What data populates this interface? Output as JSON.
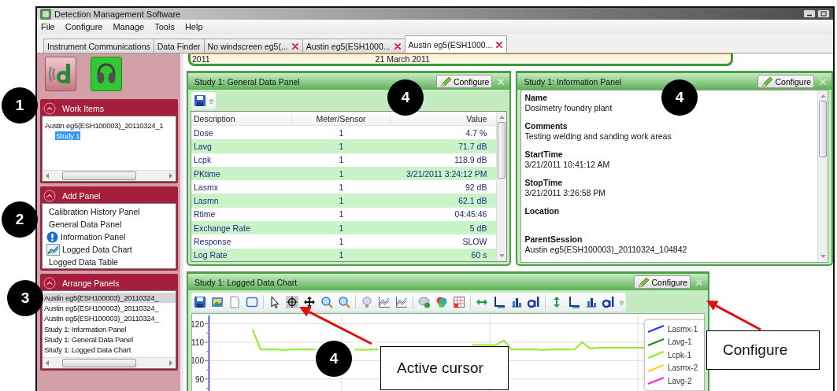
{
  "window": {
    "title": "Detection Management Software"
  },
  "menu": [
    "File",
    "Configure",
    "Manage",
    "Tools",
    "Help"
  ],
  "tabs": [
    {
      "label": "Instrument Communications",
      "closable": false,
      "selected": false
    },
    {
      "label": "Data Finder",
      "closable": false,
      "selected": false
    },
    {
      "label": "No windscreen eg5(...",
      "closable": true,
      "selected": false
    },
    {
      "label": "Austin eg5(ESH1000...",
      "closable": true,
      "selected": false
    },
    {
      "label": "Austin eg5(ESH1000...",
      "closable": true,
      "selected": true
    }
  ],
  "sidebar": {
    "launch_buttons": [
      {
        "kind": "logo"
      },
      {
        "kind": "headphones"
      }
    ],
    "work_items": {
      "title": "Work Items",
      "tree": [
        {
          "label": "Austin eg5(ESH100003)_20110324_1",
          "selected": false,
          "children": [
            {
              "label": "Study 1",
              "selected": true
            }
          ]
        }
      ]
    },
    "add_panel": {
      "title": "Add Panel",
      "items": [
        {
          "label": "Calibration History Panel",
          "kind": "plain"
        },
        {
          "label": "General Data Panel",
          "kind": "plain"
        },
        {
          "label": "Information Panel",
          "kind": "info"
        },
        {
          "label": "Logged Data Chart",
          "kind": "chart"
        },
        {
          "label": "Logged Data Table",
          "kind": "plain"
        }
      ]
    },
    "arrange_panels": {
      "title": "Arrange Panels",
      "items": [
        {
          "label": "Austin eg5(ESH100003)_20110324_",
          "selected": true
        },
        {
          "label": "Austin eg5(ESH100003)_20110324_",
          "selected": false
        },
        {
          "label": "Austin eg5(ESH100003)_20110324_",
          "selected": false
        },
        {
          "label": "Study 1: Information Panel",
          "selected": false
        },
        {
          "label": "Study 1: General Data Panel",
          "selected": false
        },
        {
          "label": "Study 1: Logged Data Chart",
          "selected": false
        }
      ]
    }
  },
  "timeline": {
    "year": "2011",
    "date": "21 March 2011"
  },
  "general_panel": {
    "title": "Study 1: General Data Panel",
    "configure": "Configure",
    "columns": [
      "Description",
      "Meter/Sensor",
      "Value"
    ],
    "rows": [
      [
        "Dose",
        "1",
        "4.7 %"
      ],
      [
        "Lavg",
        "1",
        "71.7 dB"
      ],
      [
        "Lcpk",
        "1",
        "118.9 dB"
      ],
      [
        "PKtime",
        "1",
        "3/21/2011 3:24:12 PM"
      ],
      [
        "Lasmx",
        "1",
        "92 dB"
      ],
      [
        "Lasmn",
        "1",
        "62.1 dB"
      ],
      [
        "Rtime",
        "1",
        "04:45:46"
      ],
      [
        "Exchange Rate",
        "1",
        "5 dB"
      ],
      [
        "Response",
        "1",
        "SLOW"
      ],
      [
        "Log Rate",
        "1",
        "60 s"
      ]
    ]
  },
  "info_panel": {
    "title": "Study 1: Information Panel",
    "configure": "Configure",
    "fields": [
      {
        "label": "Name",
        "value": "Dosimetry foundry plant"
      },
      {
        "label": "Comments",
        "value": "Testing welding and sanding work areas"
      },
      {
        "label": "StartTime",
        "value": "3/21/2011 10:41:12 AM"
      },
      {
        "label": "StopTime",
        "value": "3/21/2011 3:26:58 PM"
      },
      {
        "label": "Location"
      },
      {
        "label": "ParentSession",
        "value": "Austin eg5(ESH100003)_20110324_104842"
      }
    ]
  },
  "chart_panel": {
    "title": "Study 1: Logged Data Chart",
    "configure": "Configure",
    "toolbar": [
      {
        "kind": "save",
        "selected": false
      },
      {
        "kind": "image",
        "selected": false
      },
      {
        "kind": "page",
        "selected": false
      },
      {
        "kind": "window",
        "selected": false
      },
      {
        "kind": "separator"
      },
      {
        "kind": "pointer",
        "selected": false
      },
      {
        "kind": "cursor",
        "selected": true
      },
      {
        "kind": "pan",
        "selected": false
      },
      {
        "kind": "zoom-in",
        "selected": false
      },
      {
        "kind": "zoom-out",
        "selected": false
      },
      {
        "kind": "separator"
      },
      {
        "kind": "bulb",
        "selected": false
      },
      {
        "kind": "lines",
        "selected": false
      },
      {
        "kind": "lines",
        "selected": false
      },
      {
        "kind": "separator"
      },
      {
        "kind": "comment-add",
        "selected": false
      },
      {
        "kind": "colors",
        "selected": false
      },
      {
        "kind": "grid-delete",
        "selected": false
      },
      {
        "kind": "separator"
      },
      {
        "kind": "h-arrows",
        "selected": false
      },
      {
        "kind": "axis",
        "selected": false
      },
      {
        "kind": "bars",
        "selected": false
      },
      {
        "kind": "text-style",
        "selected": false
      },
      {
        "kind": "separator"
      },
      {
        "kind": "v-arrows",
        "selected": false
      },
      {
        "kind": "axis",
        "selected": false
      },
      {
        "kind": "bars",
        "selected": false
      },
      {
        "kind": "text-style",
        "selected": false
      }
    ],
    "chart_data": {
      "type": "line",
      "ylim": [
        83.5,
        124.5
      ],
      "yticks": [
        90,
        100,
        110,
        120
      ],
      "grid": true,
      "categories": [
        null,
        null,
        null,
        null,
        null,
        null,
        null,
        null,
        null,
        null,
        null,
        null,
        null,
        null,
        null,
        null,
        null,
        null,
        null,
        null,
        null,
        null,
        null,
        null,
        null,
        null,
        null,
        null,
        null,
        null,
        null,
        null,
        null,
        null,
        null,
        null,
        null,
        null,
        null,
        null,
        null,
        null,
        null,
        null,
        null,
        null,
        null,
        null,
        null,
        null,
        null,
        null,
        null,
        null,
        null,
        null,
        null,
        null,
        null,
        null,
        null,
        null,
        null,
        null
      ],
      "series": [
        {
          "name": "Lasmx-1",
          "color": "#2030ff",
          "values": [
            null,
            null,
            null,
            null,
            null,
            null,
            null,
            null,
            null,
            null,
            null,
            null,
            null,
            null,
            null,
            null,
            null,
            null,
            null,
            null,
            null,
            null,
            null,
            null,
            null,
            null,
            null,
            null,
            null,
            null,
            null,
            null,
            null,
            null,
            null,
            null,
            null,
            null,
            null,
            null,
            null,
            null,
            null,
            null,
            null,
            null,
            null,
            null,
            null,
            null,
            null,
            null,
            null,
            null,
            null,
            null,
            null,
            null,
            null,
            null,
            null,
            null,
            null,
            null
          ]
        },
        {
          "name": "Lavg-1",
          "color": "#1a8a2a",
          "values": [
            null,
            null,
            null,
            null,
            null,
            null,
            null,
            null,
            null,
            null,
            null,
            null,
            null,
            null,
            null,
            null,
            null,
            null,
            null,
            null,
            null,
            null,
            null,
            null,
            null,
            null,
            null,
            null,
            null,
            null,
            null,
            null,
            null,
            null,
            null,
            null,
            null,
            null,
            null,
            null,
            null,
            null,
            null,
            null,
            null,
            null,
            null,
            null,
            null,
            null,
            null,
            null,
            null,
            null,
            null,
            null,
            null,
            null,
            null,
            null,
            null,
            null,
            null,
            null
          ]
        },
        {
          "name": "Lcpk-1",
          "color": "#90ee20",
          "values": [
            null,
            null,
            null,
            null,
            null,
            117,
            106,
            106,
            106,
            105.8,
            106,
            106,
            106,
            106,
            null,
            null,
            null,
            null,
            106,
            105.8,
            106,
            106,
            null,
            null,
            null,
            null,
            null,
            null,
            null,
            null,
            null,
            null,
            null,
            108.5,
            108.5,
            108.5,
            108.5,
            111,
            106,
            106,
            106,
            106,
            105.8,
            106,
            106,
            106,
            106,
            110,
            106.5,
            107,
            107,
            107,
            107,
            107,
            107,
            107,
            null,
            null,
            null,
            null,
            null,
            null,
            null,
            null
          ]
        },
        {
          "name": "Lasmx-2",
          "color": "#ffd020",
          "values": [
            null,
            null,
            null,
            null,
            null,
            null,
            null,
            null,
            null,
            null,
            null,
            null,
            null,
            null,
            null,
            null,
            null,
            null,
            null,
            null,
            null,
            null,
            null,
            null,
            null,
            null,
            null,
            null,
            null,
            null,
            null,
            null,
            null,
            null,
            null,
            null,
            null,
            null,
            null,
            null,
            null,
            null,
            null,
            null,
            null,
            null,
            null,
            null,
            null,
            null,
            null,
            null,
            null,
            null,
            null,
            null,
            null,
            null,
            null,
            null,
            null,
            null,
            null,
            null
          ]
        },
        {
          "name": "Lavg-2",
          "color": "#ff20e0",
          "values": [
            null,
            null,
            null,
            null,
            null,
            null,
            null,
            null,
            null,
            null,
            null,
            null,
            null,
            null,
            null,
            null,
            null,
            null,
            null,
            null,
            null,
            null,
            null,
            null,
            null,
            null,
            null,
            null,
            null,
            null,
            null,
            null,
            null,
            null,
            null,
            null,
            null,
            null,
            null,
            null,
            null,
            null,
            null,
            null,
            null,
            null,
            null,
            null,
            null,
            null,
            null,
            null,
            null,
            null,
            null,
            null,
            null,
            null,
            null,
            null,
            null,
            null,
            null,
            null
          ]
        }
      ]
    }
  },
  "annotations": {
    "callouts": [
      "1",
      "2",
      "3",
      "4",
      "4",
      "4"
    ],
    "labels": [
      "Active cursor",
      "Configure"
    ]
  }
}
